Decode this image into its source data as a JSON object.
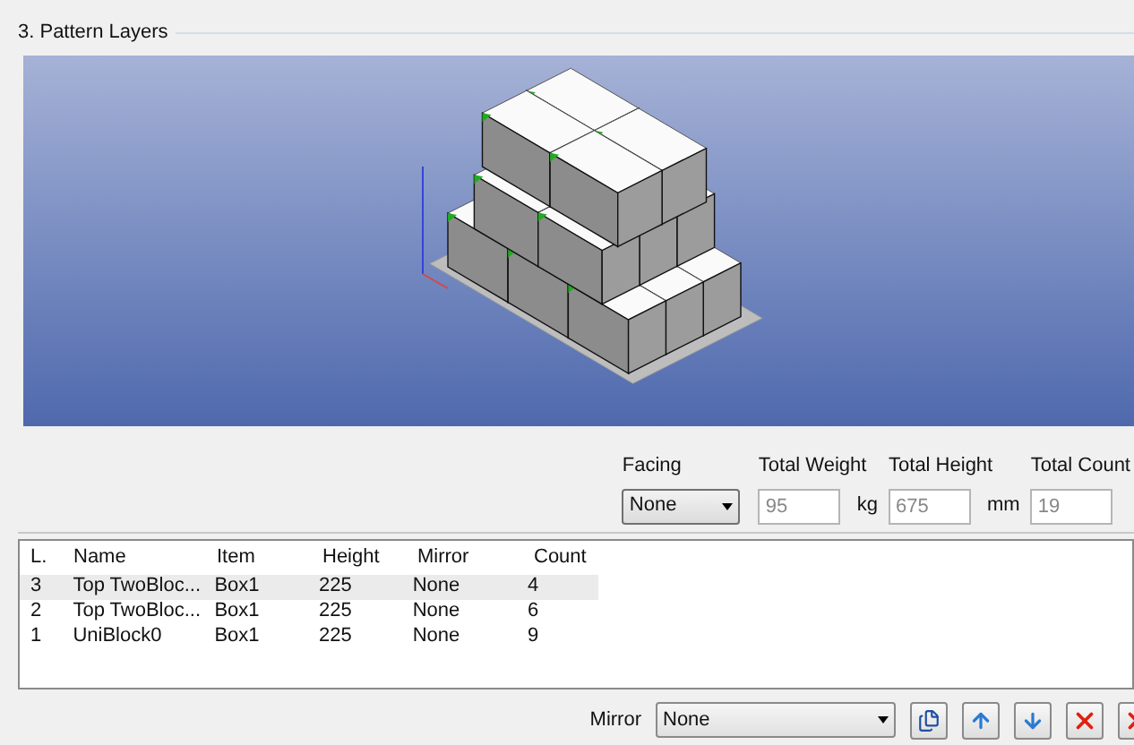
{
  "group_title": "3. Pattern Layers",
  "facing": {
    "label": "Facing",
    "value": "None"
  },
  "totals": [
    {
      "label": "Total Weight",
      "value": "95",
      "unit": "kg"
    },
    {
      "label": "Total Height",
      "value": "675",
      "unit": "mm"
    },
    {
      "label": "Total Count",
      "value": "19"
    }
  ],
  "table": {
    "columns": [
      "L.",
      "Name",
      "Item",
      "Height",
      "Mirror",
      "Count"
    ],
    "rows": [
      {
        "cells": [
          "3",
          "Top TwoBloc...",
          "Box1",
          "225",
          "None",
          "4"
        ],
        "selected": true
      },
      {
        "cells": [
          "2",
          "Top TwoBloc...",
          "Box1",
          "225",
          "None",
          "6"
        ],
        "selected": false
      },
      {
        "cells": [
          "1",
          "UniBlock0",
          "Box1",
          "225",
          "None",
          "9"
        ],
        "selected": false
      }
    ]
  },
  "mirror": {
    "label": "Mirror",
    "value": "None"
  },
  "toolbar": [
    {
      "kind": "copy"
    },
    {
      "kind": "up"
    },
    {
      "kind": "down"
    },
    {
      "kind": "delete"
    },
    {
      "kind": "delete-cut"
    }
  ]
}
